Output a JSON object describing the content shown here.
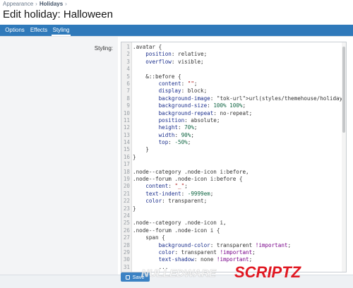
{
  "breadcrumb": [
    {
      "label": "Appearance"
    },
    {
      "label": "Holidays"
    }
  ],
  "page": {
    "title": "Edit holiday: Halloween"
  },
  "tabs": [
    {
      "label": "Options"
    },
    {
      "label": "Effects"
    },
    {
      "label": "Styling"
    }
  ],
  "form": {
    "styling_label": "Styling:"
  },
  "editor": {
    "lines": [
      ".avatar {",
      "    position: relative;",
      "    overflow: visible;",
      "",
      "    &::before {",
      "        content: \"\";",
      "        display: block;",
      "        background-image: url(styles/themehouse/holidays/halloween/w",
      "        background-size: 100% 100%;",
      "        background-repeat: no-repeat;",
      "        position: absolute;",
      "        height: 70%;",
      "        width: 90%;",
      "        top: -50%;",
      "    }",
      "}",
      "",
      ".node--category .node-icon i:before,",
      ".node--forum .node-icon i:before {",
      "    content: \"_\";",
      "    text-indent: -9999em;",
      "    color: transparent;",
      "}",
      "",
      ".node--category .node-icon i,",
      ".node--forum .node-icon i {",
      "    span {",
      "        background-color: transparent !important;",
      "        color: transparent !important;",
      "        text-shadow: none !important;",
      "        ..."
    ]
  },
  "save_button": {
    "label": "Save"
  },
  "watermark": {
    "text": "SCRIPTZ"
  },
  "colors": {
    "tab_bar": "#2f79ba",
    "accent": "#3b82c4",
    "watermark_red": "#e01822"
  }
}
